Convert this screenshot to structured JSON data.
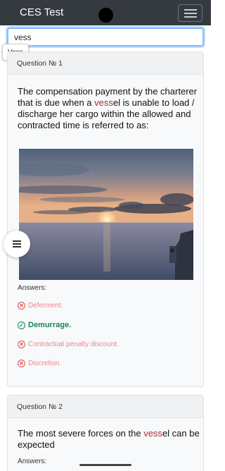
{
  "app": {
    "title": "CES Test"
  },
  "search": {
    "value": "vess"
  },
  "autocomplete": {
    "suggestion": "Vess"
  },
  "questions": [
    {
      "header": "Question № 1",
      "text_parts": [
        "The compensation payment by the charterer that is due when a ",
        "vess",
        "el is unable to load / discharge her cargo within the allowed and contracted time is referred to as:"
      ],
      "image": "sunset over sea",
      "answers_label": "Answers:",
      "answers": [
        {
          "label": "Deferment.",
          "status": "wrong"
        },
        {
          "label": "Demurrage.",
          "status": "correct"
        },
        {
          "label": "Contractual penalty discount.",
          "status": "wrong"
        },
        {
          "label": "Discretion.",
          "status": "wrong"
        }
      ]
    },
    {
      "header": "Question № 2",
      "text_parts": [
        "The most severe forces on the ",
        "vess",
        "el can be expected"
      ],
      "answers_label": "Answers:"
    }
  ],
  "icons": {
    "menu": "hamburger-icon",
    "fab": "hamburger-icon",
    "wrong": "x-circle-icon",
    "correct": "check-circle-icon"
  },
  "colors": {
    "navbar": "#343a40",
    "highlight": "#b02a37",
    "correct": "#198754",
    "wrong": "#d9534f"
  }
}
